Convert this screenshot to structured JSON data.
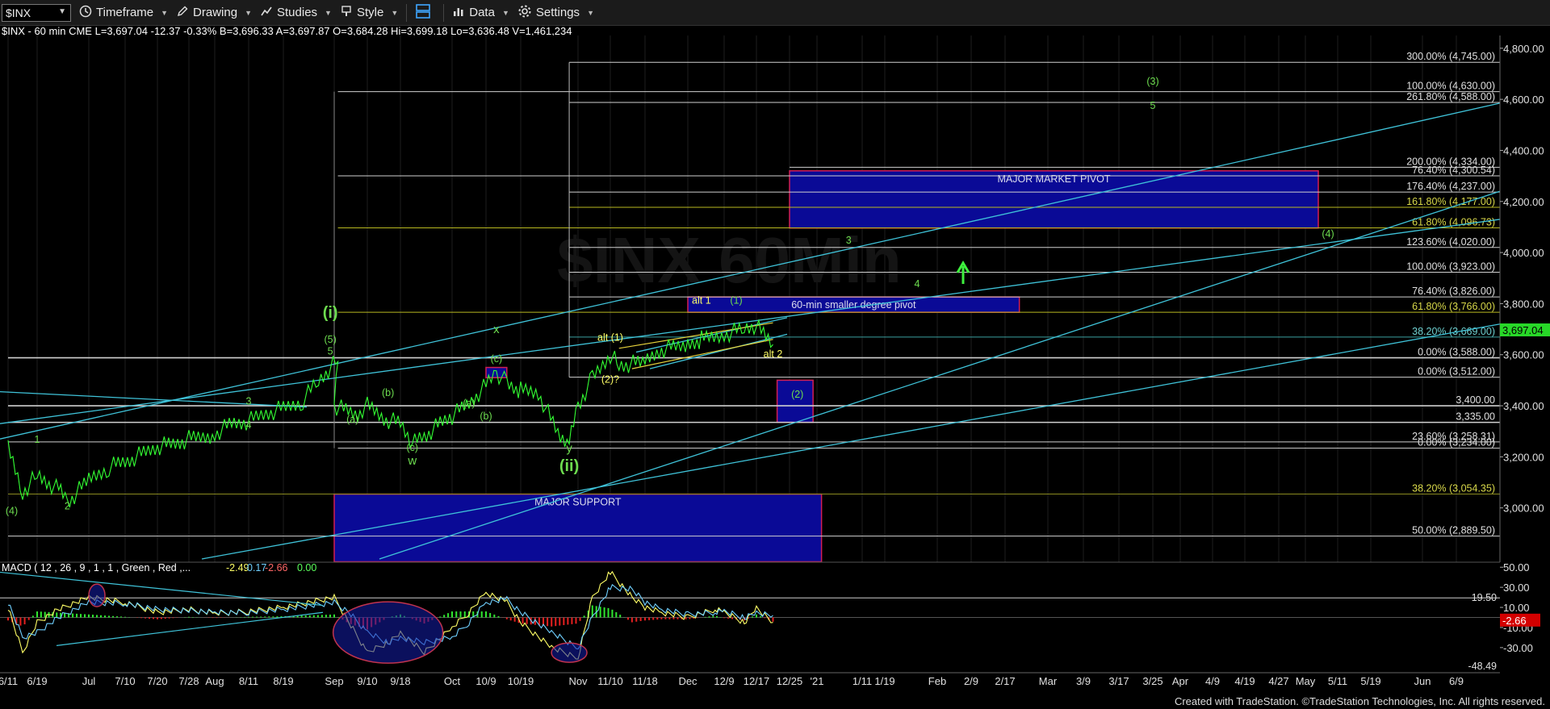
{
  "toolbar": {
    "symbol": "$INX",
    "items": [
      {
        "label": "Timeframe",
        "icon": "clock-icon"
      },
      {
        "label": "Drawing",
        "icon": "pencil-icon"
      },
      {
        "label": "Studies",
        "icon": "studies-icon"
      },
      {
        "label": "Style",
        "icon": "brush-icon"
      },
      {
        "label": "",
        "icon": "layout-icon"
      },
      {
        "label": "Data",
        "icon": "data-icon"
      },
      {
        "label": "Settings",
        "icon": "gear-icon"
      }
    ]
  },
  "header": "$INX - 60 min CME  L=3,697.04 -12.37 -0.33% B=3,696.33 A=3,697.87 O=3,684.28 Hi=3,699.18 Lo=3,636.48 V=1,461,234",
  "footer": "Created with TradeStation. ©TradeStation Technologies, Inc. All rights reserved.",
  "colors": {
    "price": "#33ff33",
    "wave": "#6ddc4f",
    "alt": "#ffff66",
    "trend": "#3fc3d9",
    "pivot_fill": "#0a0a96",
    "pivot_border": "#d21e54",
    "fib_line": "#d0d0d0"
  },
  "chart_data": [
    {
      "type": "line",
      "title": "",
      "ylim": [
        2800,
        4850
      ],
      "y_ticks": [
        3000,
        3200,
        3400,
        3600,
        3800,
        4000,
        4200,
        4400,
        4600,
        4800
      ],
      "y_tick_labels": [
        "3,000.00",
        "3,200.00",
        "3,400.00",
        "3,600.00",
        "3,800.00",
        "4,000.00",
        "4,200.00",
        "4,400.00",
        "4,600.00",
        "4,800.00"
      ],
      "x_tick_labels": [
        "6/11",
        "6/19",
        "Jul",
        "7/10",
        "7/20",
        "7/28",
        "Aug",
        "8/11",
        "8/19",
        "Sep",
        "9/10",
        "9/18",
        "Oct",
        "10/9",
        "10/19",
        "Nov",
        "11/10",
        "11/18",
        "Dec",
        "12/9",
        "12/17",
        "12/25",
        "'21",
        "1/11",
        "1/19",
        "Feb",
        "2/9",
        "2/17",
        "Mar",
        "3/9",
        "3/17",
        "3/25",
        "Apr",
        "4/9",
        "4/19",
        "4/27",
        "May",
        "5/11",
        "5/19",
        "Jun",
        "6/9"
      ],
      "price_series": {
        "name": "$INX",
        "x": [
          "6/11",
          "6/15",
          "6/19",
          "6/24",
          "6/26",
          "Jul",
          "7/6",
          "7/10",
          "7/15",
          "7/20",
          "7/24",
          "7/28",
          "Aug",
          "8/6",
          "8/11",
          "8/15",
          "8/19",
          "8/24",
          "8/28",
          "9/2",
          "Sep",
          "9/8",
          "9/10",
          "9/14",
          "9/18",
          "9/21",
          "9/24",
          "9/28",
          "Oct",
          "10/5",
          "10/9",
          "10/12",
          "10/15",
          "10/19",
          "10/23",
          "10/28",
          "10/30",
          "Nov",
          "11/5",
          "11/10",
          "11/12",
          "11/18",
          "11/23",
          "Dec",
          "12/4",
          "12/9",
          "12/14",
          "12/17",
          "12/21"
        ],
        "values": [
          3230,
          3060,
          3130,
          3070,
          3020,
          3110,
          3160,
          3180,
          3210,
          3240,
          3250,
          3270,
          3290,
          3330,
          3340,
          3370,
          3390,
          3420,
          3500,
          3580,
          3400,
          3360,
          3400,
          3350,
          3330,
          3250,
          3280,
          3330,
          3360,
          3410,
          3480,
          3530,
          3490,
          3460,
          3450,
          3270,
          3250,
          3400,
          3510,
          3600,
          3560,
          3570,
          3620,
          3640,
          3660,
          3680,
          3700,
          3710,
          3640
        ]
      },
      "fib_levels": [
        {
          "label": "300.00% (4,745.00)",
          "value": 4745
        },
        {
          "label": "100.00% (4,630.00)",
          "value": 4630
        },
        {
          "label": "261.80% (4,588.00)",
          "value": 4588
        },
        {
          "label": "200.00% (4,334.00)",
          "value": 4334
        },
        {
          "label": "76.40% (4,300.54)",
          "value": 4300.54
        },
        {
          "label": "176.40% (4,237.00)",
          "value": 4237
        },
        {
          "label": "161.80% (4,177.00)",
          "value": 4177
        },
        {
          "label": "61.80% (4,096.73)",
          "value": 4096.73
        },
        {
          "label": "123.60% (4,020.00)",
          "value": 4020
        },
        {
          "label": "100.00% (3,923.00)",
          "value": 3923
        },
        {
          "label": "76.40% (3,826.00)",
          "value": 3826
        },
        {
          "label": "61.80% (3,766.00)",
          "value": 3766
        },
        {
          "label": "38.20% (3,669.00)",
          "value": 3669
        },
        {
          "label": "0.00% (3,588.00)",
          "value": 3588
        },
        {
          "label": "0.00% (3,512.00)",
          "value": 3512
        },
        {
          "label": "3,400.00",
          "value": 3400
        },
        {
          "label": "3,335.00",
          "value": 3335
        },
        {
          "label": "23.60% (3,258.31)",
          "value": 3258.31
        },
        {
          "label": "0.00% (3,234.00)",
          "value": 3234
        },
        {
          "label": "38.20% (3,054.35)",
          "value": 3054.35
        },
        {
          "label": "50.00% (2,889.50)",
          "value": 2889.5
        }
      ],
      "zones": [
        {
          "label": "MAJOR MARKET PIVOT",
          "x_from": "12/25",
          "x_to": "5/5",
          "y_from": 4096,
          "y_to": 4320
        },
        {
          "label": "60-min smaller degree pivot",
          "x_from": "12/1",
          "x_to": "2/21",
          "y_from": 3766,
          "y_to": 3826
        },
        {
          "label": "",
          "x_from": "12/22",
          "x_to": "12/31",
          "y_from": 3335,
          "y_to": 3500
        },
        {
          "label": "MAJOR SUPPORT",
          "x_from": "Sep",
          "x_to": "1/2",
          "y_from": 2789,
          "y_to": 3054
        },
        {
          "label": "",
          "x_from": "10/9",
          "x_to": "10/15",
          "y_from": 3510,
          "y_to": 3550
        }
      ],
      "wave_labels": [
        {
          "text": "(4)",
          "x": "6/12",
          "y": 2975,
          "color": "wave"
        },
        {
          "text": "1",
          "x": "6/19",
          "y": 3255,
          "color": "wave"
        },
        {
          "text": "2",
          "x": "6/26",
          "y": 2995,
          "color": "wave"
        },
        {
          "text": "3",
          "x": "8/11",
          "y": 3405,
          "color": "wave"
        },
        {
          "text": "4",
          "x": "8/11",
          "y": 3312,
          "color": "wave"
        },
        {
          "text": "5",
          "x": "8/31",
          "y": 3600,
          "color": "wave"
        },
        {
          "text": "(5)",
          "x": "8/31",
          "y": 3647,
          "color": "wave"
        },
        {
          "text": "(i)",
          "x": "8/31",
          "y": 3745,
          "color": "wave",
          "size": "big"
        },
        {
          "text": "(a)",
          "x": "9/6",
          "y": 3334,
          "color": "wave"
        },
        {
          "text": "(b)",
          "x": "9/15",
          "y": 3438,
          "color": "wave"
        },
        {
          "text": "(c)",
          "x": "9/21",
          "y": 3223,
          "color": "wave"
        },
        {
          "text": "w",
          "x": "9/21",
          "y": 3170,
          "color": "wave",
          "size": "mid"
        },
        {
          "text": "(a)",
          "x": "10/5",
          "y": 3397,
          "color": "wave"
        },
        {
          "text": "(b)",
          "x": "10/9",
          "y": 3346,
          "color": "wave"
        },
        {
          "text": "(c)",
          "x": "10/12",
          "y": 3571,
          "color": "wave"
        },
        {
          "text": "x",
          "x": "10/12",
          "y": 3685,
          "color": "wave",
          "size": "mid"
        },
        {
          "text": "y",
          "x": "10/30",
          "y": 3218,
          "color": "wave",
          "size": "mid"
        },
        {
          "text": "(ii)",
          "x": "10/30",
          "y": 3145,
          "color": "wave",
          "size": "big"
        },
        {
          "text": "alt (1)",
          "x": "11/10",
          "y": 3655,
          "color": "alt"
        },
        {
          "text": "(2)?",
          "x": "11/10",
          "y": 3490,
          "color": "alt"
        },
        {
          "text": "alt 1",
          "x": "12/4",
          "y": 3800,
          "color": "alt"
        },
        {
          "text": "(1)",
          "x": "12/12",
          "y": 3800,
          "color": "wave"
        },
        {
          "text": "alt 2",
          "x": "12/21",
          "y": 3590,
          "color": "alt"
        },
        {
          "text": "(2)",
          "x": "12/27",
          "y": 3432,
          "color": "wave"
        },
        {
          "text": "3",
          "x": "1/8",
          "y": 4035,
          "color": "wave"
        },
        {
          "text": "4",
          "x": "1/27",
          "y": 3865,
          "color": "wave"
        },
        {
          "text": "(3)",
          "x": "3/25",
          "y": 4658,
          "color": "wave"
        },
        {
          "text": "5",
          "x": "3/25",
          "y": 4562,
          "color": "wave"
        },
        {
          "text": "(4)",
          "x": "5/8",
          "y": 4060,
          "color": "wave"
        }
      ],
      "last_price": {
        "label": "3,697.04",
        "value": 3697.04
      }
    },
    {
      "type": "line",
      "title": "MACD ( 12 , 26 , 9 , 1 , 1 , Green , Red ,...",
      "indicator_values": [
        "-2.49",
        "0.17",
        "-2.66",
        "0.00"
      ],
      "ylim": [
        -55,
        55
      ],
      "y_ticks": [
        50,
        30,
        10,
        -10,
        -30
      ],
      "y_tick_labels": [
        "50.00",
        "30.00",
        "10.00",
        "-10.00",
        "-30.00"
      ],
      "reference_levels": [
        {
          "label": "19.50",
          "value": 19.5
        },
        {
          "label": "-48.49",
          "value": -48.49
        }
      ],
      "last_value": {
        "label": "-2.66",
        "value": -2.66
      },
      "series": [
        {
          "name": "MACD",
          "x": [
            "6/11",
            "6/15",
            "6/19",
            "6/24",
            "Jul",
            "7/10",
            "7/20",
            "7/28",
            "Aug",
            "8/11",
            "8/19",
            "Sep",
            "9/5",
            "9/10",
            "9/15",
            "9/18",
            "9/24",
            "Oct",
            "10/5",
            "10/9",
            "10/15",
            "10/19",
            "10/26",
            "Nov",
            "11/5",
            "11/10",
            "11/15",
            "11/18",
            "11/23",
            "Dec",
            "12/7",
            "12/9",
            "12/14",
            "12/17",
            "12/21"
          ],
          "values": [
            10,
            -35,
            -5,
            8,
            20,
            15,
            5,
            8,
            4,
            6,
            10,
            20,
            -5,
            -35,
            -25,
            -15,
            -35,
            -10,
            5,
            25,
            15,
            -5,
            -30,
            -40,
            20,
            45,
            20,
            10,
            5,
            0,
            8,
            5,
            -5,
            10,
            -5
          ]
        },
        {
          "name": "Signal",
          "x": [
            "6/11",
            "6/15",
            "6/19",
            "6/24",
            "Jul",
            "7/10",
            "7/20",
            "7/28",
            "Aug",
            "8/11",
            "8/19",
            "Sep",
            "9/5",
            "9/10",
            "9/15",
            "9/18",
            "9/24",
            "Oct",
            "10/5",
            "10/9",
            "10/15",
            "10/19",
            "10/26",
            "Nov",
            "11/5",
            "11/10",
            "11/15",
            "11/18",
            "11/23",
            "Dec",
            "12/7",
            "12/9",
            "12/14",
            "12/17",
            "12/21"
          ],
          "values": [
            15,
            -20,
            -15,
            0,
            15,
            14,
            8,
            7,
            5,
            5,
            8,
            15,
            5,
            -15,
            -25,
            -20,
            -25,
            -20,
            -5,
            15,
            18,
            5,
            -15,
            -30,
            0,
            30,
            28,
            15,
            8,
            3,
            5,
            6,
            0,
            5,
            2
          ]
        }
      ]
    }
  ]
}
